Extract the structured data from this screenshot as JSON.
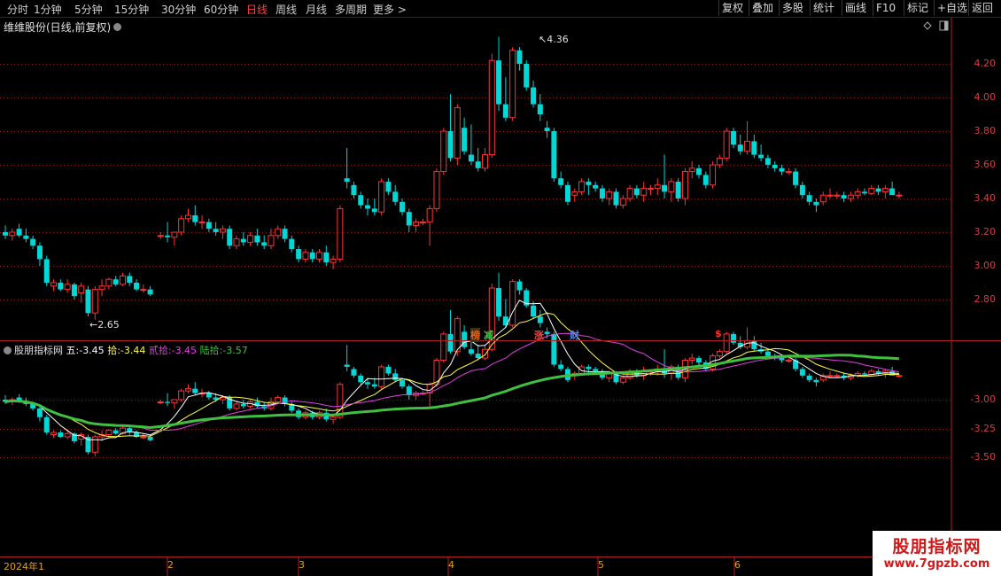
{
  "toolbar": {
    "periods": [
      "分时",
      "1分钟",
      "5分钟",
      "15分钟",
      "30分钟",
      "60分钟",
      "日线",
      "周线",
      "月线",
      "多周期",
      "更多"
    ],
    "active_period": "日线",
    "right_buttons": [
      "复权",
      "叠加",
      "多股",
      "统计",
      "画线",
      "F10",
      "标记",
      "+自选",
      "返回"
    ]
  },
  "main_chart": {
    "title": "维维股份(日线,前复权)",
    "max_label": "4.36",
    "min_label": "2.65",
    "price_ticks": [
      "4.20",
      "4.00",
      "3.80",
      "3.60",
      "3.40",
      "3.20",
      "3.00",
      "2.80"
    ],
    "events": [
      {
        "text": "榜",
        "color": "#e06020"
      },
      {
        "text": "减",
        "color": "#40c040"
      },
      {
        "text": "涨",
        "color": "#ff4040"
      },
      {
        "text": "财",
        "color": "#4080ff"
      },
      {
        "text": "$",
        "color": "#ff3030"
      }
    ]
  },
  "indicator": {
    "name": "股朋指标网",
    "values": [
      {
        "label": "五",
        "value": "-3.45",
        "color": "#ffffff"
      },
      {
        "label": "拾",
        "value": "-3.44",
        "color": "#ffff40"
      },
      {
        "label": "贰拾",
        "value": "-3.45",
        "color": "#e040e0"
      },
      {
        "label": "陆拾",
        "value": "-3.57",
        "color": "#40c040"
      }
    ],
    "ticks": [
      "-3.00",
      "-3.25",
      "-3.50"
    ]
  },
  "dates": [
    "2024年1",
    "2",
    "3",
    "4",
    "5",
    "6"
  ],
  "watermark": {
    "line1": "股朋指标网",
    "line2": "www.7gpzb.com"
  },
  "colors": {
    "up": "#ff3232",
    "down": "#00d8d8",
    "ma5": "#ffffff",
    "ma10": "#ffff40",
    "ma20": "#e040e0",
    "ma60": "#40c040"
  },
  "chart_data": {
    "type": "candlestick",
    "title": "维维股份(日线,前复权)",
    "ylim": [
      2.7,
      4.36
    ],
    "ohlc": [
      [
        3.2,
        3.24,
        3.16,
        3.18
      ],
      [
        3.18,
        3.22,
        3.15,
        3.2
      ],
      [
        3.22,
        3.25,
        3.17,
        3.18
      ],
      [
        3.18,
        3.22,
        3.14,
        3.16
      ],
      [
        3.16,
        3.18,
        3.1,
        3.12
      ],
      [
        3.12,
        3.14,
        3.0,
        3.04
      ],
      [
        3.04,
        3.06,
        2.88,
        2.9
      ],
      [
        2.88,
        2.92,
        2.85,
        2.9
      ],
      [
        2.9,
        2.92,
        2.85,
        2.86
      ],
      [
        2.86,
        2.92,
        2.84,
        2.89
      ],
      [
        2.89,
        2.9,
        2.8,
        2.82
      ],
      [
        2.84,
        2.9,
        2.78,
        2.88
      ],
      [
        2.86,
        2.88,
        2.7,
        2.72
      ],
      [
        2.72,
        2.88,
        2.68,
        2.86
      ],
      [
        2.86,
        2.92,
        2.82,
        2.88
      ],
      [
        2.88,
        2.93,
        2.86,
        2.92
      ],
      [
        2.92,
        2.94,
        2.88,
        2.89
      ],
      [
        2.89,
        2.96,
        2.88,
        2.94
      ],
      [
        2.94,
        2.96,
        2.88,
        2.9
      ],
      [
        2.9,
        2.92,
        2.85,
        2.86
      ],
      [
        2.86,
        2.89,
        2.84,
        2.86
      ],
      [
        2.86,
        2.88,
        2.82,
        2.83
      ],
      [
        3.18,
        3.2,
        3.16,
        3.18
      ],
      [
        3.18,
        3.26,
        3.14,
        3.17
      ],
      [
        3.17,
        3.2,
        3.12,
        3.2
      ],
      [
        3.2,
        3.3,
        3.18,
        3.28
      ],
      [
        3.28,
        3.34,
        3.26,
        3.3
      ],
      [
        3.3,
        3.36,
        3.24,
        3.26
      ],
      [
        3.26,
        3.3,
        3.22,
        3.26
      ],
      [
        3.26,
        3.28,
        3.2,
        3.22
      ],
      [
        3.22,
        3.26,
        3.18,
        3.2
      ],
      [
        3.2,
        3.24,
        3.16,
        3.22
      ],
      [
        3.22,
        3.24,
        3.1,
        3.12
      ],
      [
        3.12,
        3.18,
        3.1,
        3.16
      ],
      [
        3.16,
        3.2,
        3.12,
        3.14
      ],
      [
        3.14,
        3.2,
        3.12,
        3.18
      ],
      [
        3.18,
        3.22,
        3.12,
        3.14
      ],
      [
        3.14,
        3.18,
        3.1,
        3.12
      ],
      [
        3.12,
        3.22,
        3.1,
        3.18
      ],
      [
        3.18,
        3.24,
        3.16,
        3.22
      ],
      [
        3.22,
        3.24,
        3.14,
        3.16
      ],
      [
        3.16,
        3.18,
        3.08,
        3.1
      ],
      [
        3.1,
        3.12,
        3.02,
        3.04
      ],
      [
        3.04,
        3.1,
        3.02,
        3.08
      ],
      [
        3.08,
        3.1,
        3.02,
        3.04
      ],
      [
        3.04,
        3.1,
        3.02,
        3.08
      ],
      [
        3.08,
        3.12,
        3.0,
        3.02
      ],
      [
        3.02,
        3.06,
        2.98,
        3.04
      ],
      [
        3.04,
        3.36,
        3.02,
        3.34
      ],
      [
        3.52,
        3.7,
        3.46,
        3.5
      ],
      [
        3.48,
        3.5,
        3.4,
        3.42
      ],
      [
        3.42,
        3.44,
        3.34,
        3.36
      ],
      [
        3.36,
        3.4,
        3.3,
        3.34
      ],
      [
        3.34,
        3.4,
        3.3,
        3.32
      ],
      [
        3.32,
        3.52,
        3.3,
        3.5
      ],
      [
        3.5,
        3.52,
        3.42,
        3.44
      ],
      [
        3.44,
        3.48,
        3.36,
        3.38
      ],
      [
        3.38,
        3.4,
        3.3,
        3.32
      ],
      [
        3.32,
        3.34,
        3.2,
        3.24
      ],
      [
        3.24,
        3.28,
        3.2,
        3.26
      ],
      [
        3.26,
        3.28,
        3.24,
        3.26
      ],
      [
        3.26,
        3.36,
        3.12,
        3.34
      ],
      [
        3.34,
        3.58,
        3.32,
        3.56
      ],
      [
        3.56,
        3.82,
        3.54,
        3.8
      ],
      [
        3.8,
        4.02,
        3.62,
        3.64
      ],
      [
        3.64,
        3.96,
        3.6,
        3.94
      ],
      [
        3.82,
        3.88,
        3.66,
        3.68
      ],
      [
        3.66,
        3.84,
        3.6,
        3.62
      ],
      [
        3.62,
        3.7,
        3.56,
        3.58
      ],
      [
        3.58,
        3.7,
        3.56,
        3.66
      ],
      [
        3.66,
        4.26,
        3.64,
        4.22
      ],
      [
        4.22,
        4.36,
        3.92,
        3.96
      ],
      [
        3.96,
        4.12,
        3.86,
        3.88
      ],
      [
        3.88,
        4.3,
        3.86,
        4.28
      ],
      [
        4.28,
        4.3,
        4.16,
        4.2
      ],
      [
        4.2,
        4.22,
        4.04,
        4.06
      ],
      [
        4.06,
        4.1,
        3.94,
        3.96
      ],
      [
        3.96,
        4.02,
        3.86,
        3.9
      ],
      [
        3.82,
        3.86,
        3.76,
        3.8
      ],
      [
        3.8,
        3.82,
        3.5,
        3.52
      ],
      [
        3.52,
        3.56,
        3.46,
        3.48
      ],
      [
        3.48,
        3.5,
        3.36,
        3.38
      ],
      [
        3.42,
        3.46,
        3.38,
        3.44
      ],
      [
        3.44,
        3.52,
        3.42,
        3.5
      ],
      [
        3.5,
        3.52,
        3.42,
        3.48
      ],
      [
        3.48,
        3.5,
        3.44,
        3.46
      ],
      [
        3.46,
        3.48,
        3.38,
        3.4
      ],
      [
        3.4,
        3.46,
        3.36,
        3.44
      ],
      [
        3.44,
        3.46,
        3.34,
        3.36
      ],
      [
        3.36,
        3.42,
        3.34,
        3.4
      ],
      [
        3.4,
        3.48,
        3.38,
        3.46
      ],
      [
        3.46,
        3.48,
        3.4,
        3.42
      ],
      [
        3.42,
        3.5,
        3.38,
        3.46
      ],
      [
        3.46,
        3.48,
        3.42,
        3.46
      ],
      [
        3.46,
        3.52,
        3.42,
        3.48
      ],
      [
        3.48,
        3.66,
        3.4,
        3.44
      ],
      [
        3.44,
        3.52,
        3.38,
        3.5
      ],
      [
        3.5,
        3.52,
        3.38,
        3.4
      ],
      [
        3.4,
        3.58,
        3.36,
        3.56
      ],
      [
        3.56,
        3.62,
        3.52,
        3.58
      ],
      [
        3.58,
        3.6,
        3.52,
        3.54
      ],
      [
        3.54,
        3.56,
        3.46,
        3.48
      ],
      [
        3.48,
        3.62,
        3.46,
        3.6
      ],
      [
        3.6,
        3.66,
        3.58,
        3.64
      ],
      [
        3.64,
        3.82,
        3.62,
        3.8
      ],
      [
        3.8,
        3.82,
        3.7,
        3.72
      ],
      [
        3.72,
        3.78,
        3.66,
        3.68
      ],
      [
        3.68,
        3.86,
        3.66,
        3.74
      ],
      [
        3.74,
        3.78,
        3.64,
        3.66
      ],
      [
        3.66,
        3.72,
        3.62,
        3.64
      ],
      [
        3.64,
        3.66,
        3.58,
        3.6
      ],
      [
        3.6,
        3.62,
        3.56,
        3.58
      ],
      [
        3.58,
        3.6,
        3.54,
        3.56
      ],
      [
        3.56,
        3.58,
        3.54,
        3.56
      ],
      [
        3.56,
        3.58,
        3.46,
        3.48
      ],
      [
        3.48,
        3.5,
        3.4,
        3.42
      ],
      [
        3.42,
        3.44,
        3.36,
        3.38
      ],
      [
        3.38,
        3.4,
        3.32,
        3.36
      ],
      [
        3.38,
        3.44,
        3.36,
        3.42
      ],
      [
        3.42,
        3.46,
        3.4,
        3.42
      ],
      [
        3.42,
        3.44,
        3.4,
        3.42
      ],
      [
        3.42,
        3.44,
        3.38,
        3.4
      ],
      [
        3.4,
        3.44,
        3.38,
        3.42
      ],
      [
        3.42,
        3.46,
        3.4,
        3.44
      ],
      [
        3.44,
        3.46,
        3.42,
        3.43
      ],
      [
        3.43,
        3.48,
        3.42,
        3.46
      ],
      [
        3.46,
        3.48,
        3.42,
        3.44
      ],
      [
        3.44,
        3.48,
        3.4,
        3.46
      ],
      [
        3.46,
        3.5,
        3.44,
        3.42
      ],
      [
        3.42,
        3.44,
        3.4,
        3.42
      ]
    ],
    "gap_after_index": 21
  }
}
